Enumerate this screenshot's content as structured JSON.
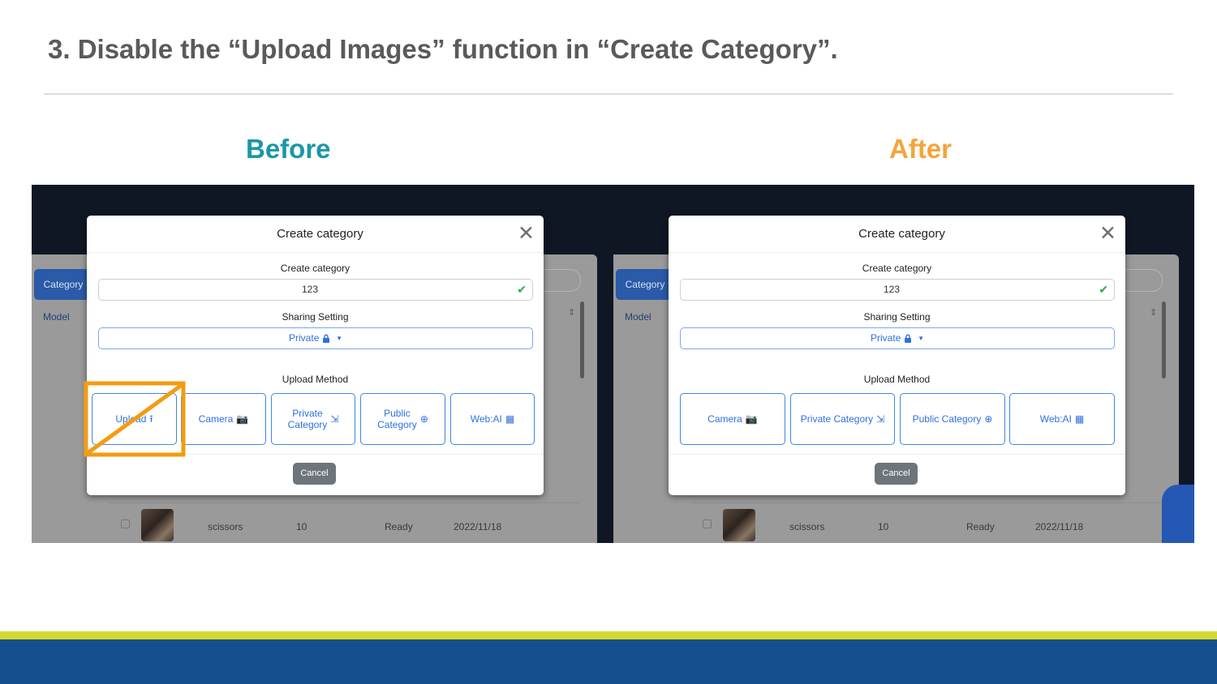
{
  "slide": {
    "title": "3. Disable the “Upload Images” function in “Create Category”.",
    "before_label": "Before",
    "after_label": "After"
  },
  "colors": {
    "before_label": "#1a97a8",
    "after_label": "#f4a43a",
    "highlight": "#f39c12",
    "footer_stripe": "#d4d832",
    "footer_band": "#164f8e",
    "button_blue": "#2f6fe0"
  },
  "background_app": {
    "sidebar_category": "Category",
    "sidebar_model": "Model",
    "row": {
      "name": "scissors",
      "count": "10",
      "status": "Ready",
      "date": "2022/11/18"
    }
  },
  "before": {
    "modal_title": "Create category",
    "category_label": "Create category",
    "category_value": "123",
    "sharing_label": "Sharing Setting",
    "sharing_value": "Private",
    "upload_method_label": "Upload Method",
    "buttons": {
      "upload": "Upload",
      "camera": "Camera",
      "private_line1": "Private",
      "private_line2": "Category",
      "public_line1": "Public",
      "public_line2": "Category",
      "web_ai": "Web:AI"
    },
    "cancel": "Cancel",
    "disabled_button": "Upload"
  },
  "after": {
    "modal_title": "Create category",
    "category_label": "Create category",
    "category_value": "123",
    "sharing_label": "Sharing Setting",
    "sharing_value": "Private",
    "upload_method_label": "Upload Method",
    "buttons": {
      "camera": "Camera",
      "private_category": "Private Category",
      "public_category": "Public Category",
      "web_ai": "Web:AI"
    },
    "cancel": "Cancel"
  },
  "icons": {
    "close": "close-icon",
    "check": "check-icon",
    "lock": "lock-icon",
    "caret": "caret-down-icon",
    "upload": "upload-icon",
    "camera": "camera-icon",
    "private_category": "file-import-icon",
    "public_category": "globe-icon",
    "web_ai": "qrcode-icon"
  }
}
